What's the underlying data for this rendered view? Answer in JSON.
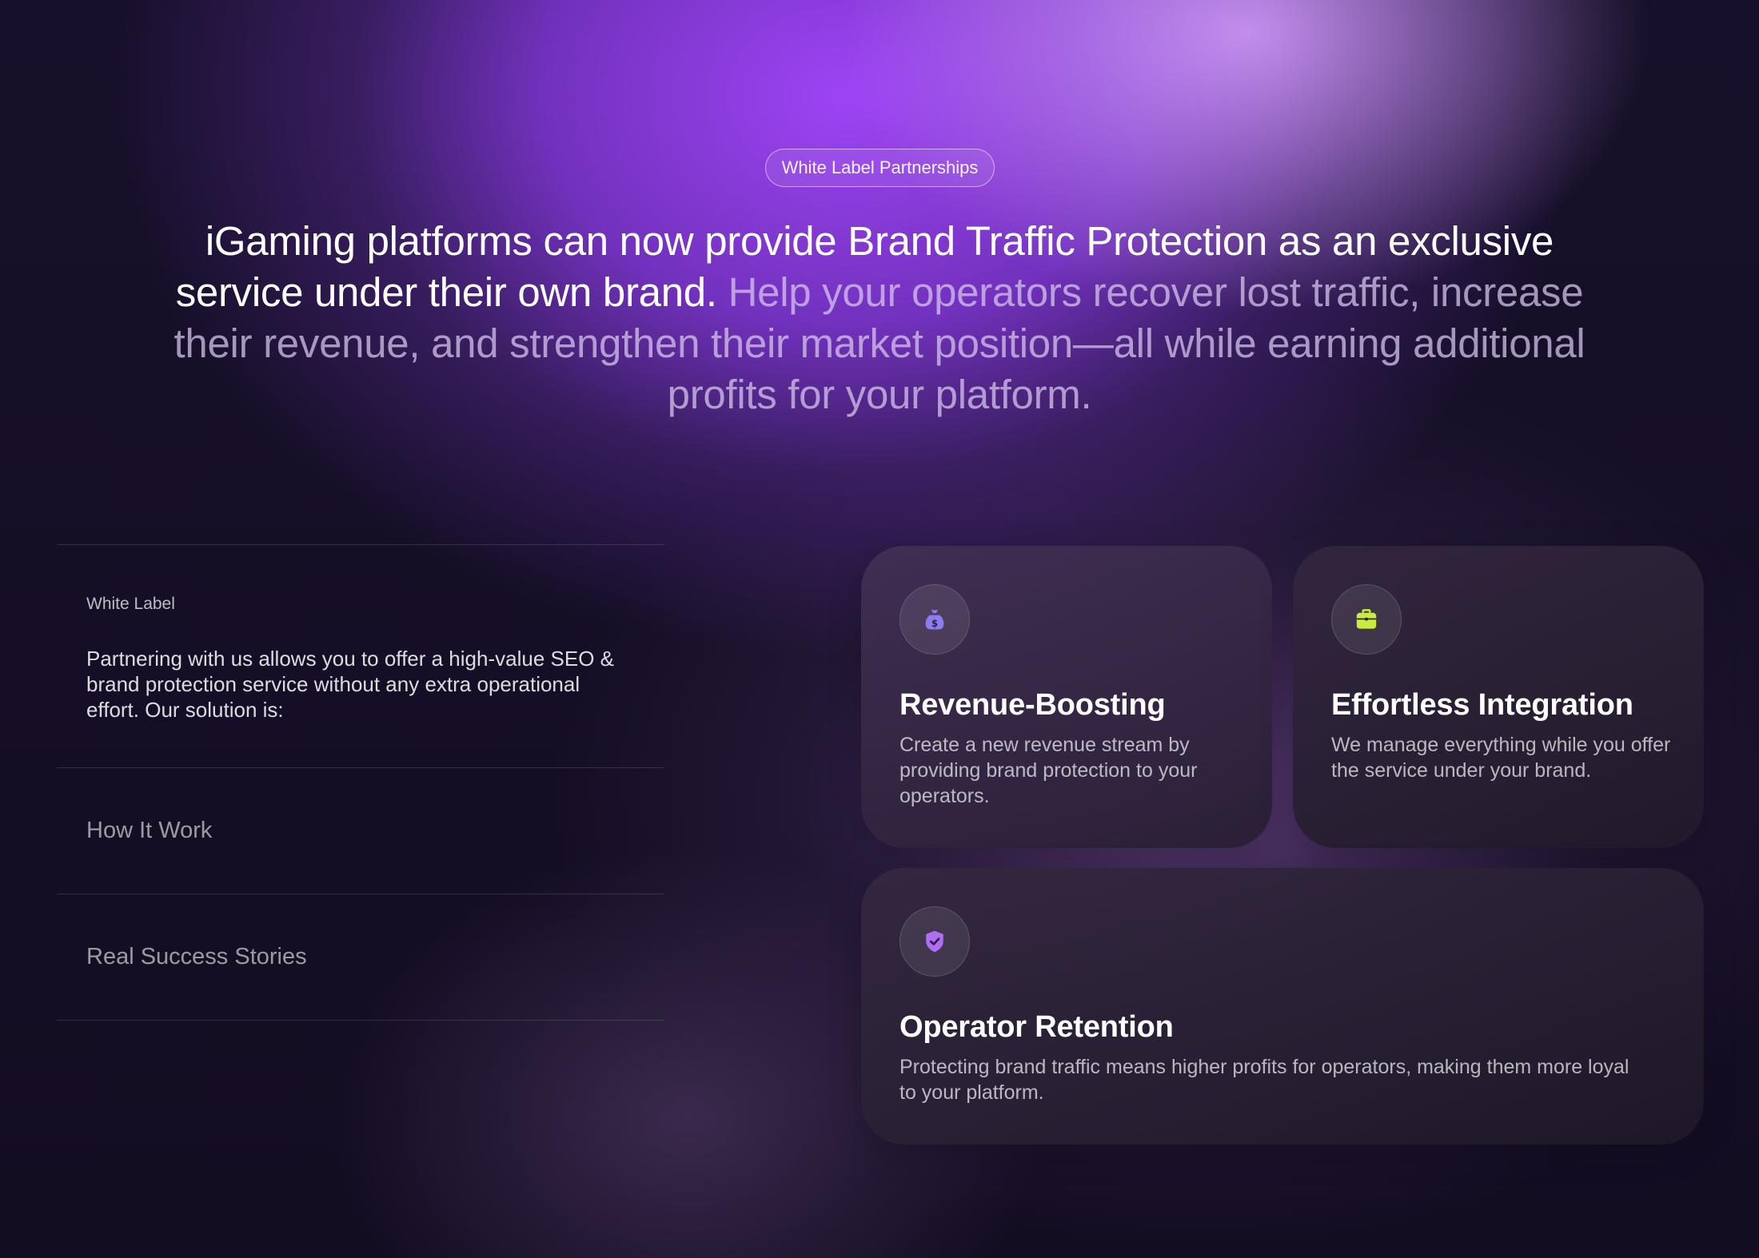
{
  "hero": {
    "pill": "White Label Partnerships",
    "headline_strong": "iGaming platforms can now provide Brand Traffic Protection as an exclusive service under their own brand.",
    "headline_muted": "Help your operators recover lost traffic, increase their revenue, and strengthen their market position—all while earning additional profits for your platform."
  },
  "sidebar": {
    "active": {
      "eyebrow": "White Label",
      "description": "Partnering with us allows you to offer a high-value SEO & brand protection service without any extra operational effort. Our solution is:"
    },
    "items": [
      {
        "label": "How It Work"
      },
      {
        "label": "Real Success Stories"
      }
    ]
  },
  "cards": [
    {
      "title": "Revenue-Boosting",
      "text": "Create a new revenue stream by providing brand protection to your operators.",
      "icon": "money-bag-icon",
      "icon_color": "#8f7bf0"
    },
    {
      "title": "Effortless Integration",
      "text": "We manage everything while you offer the service under your brand.",
      "icon": "briefcase-icon",
      "icon_color": "#c9ec3c"
    },
    {
      "title": "Operator Retention",
      "text": "Protecting brand traffic means higher profits for operators, making them more loyal to your platform.",
      "icon": "shield-check-icon",
      "icon_color": "#b16ef5"
    }
  ]
}
